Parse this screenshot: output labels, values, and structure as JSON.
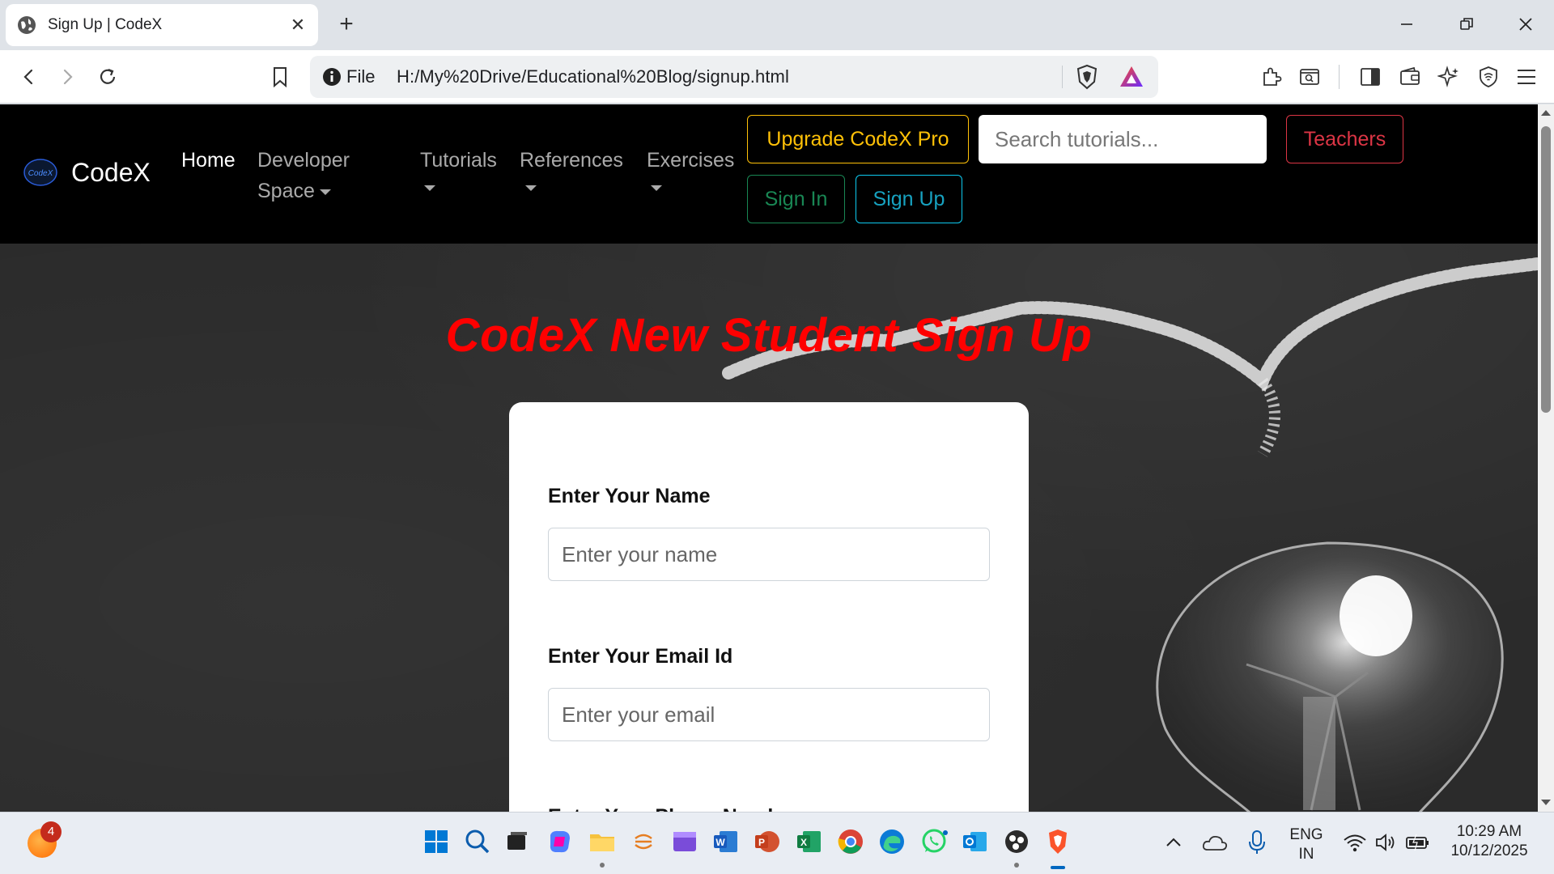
{
  "browser": {
    "tab_title": "Sign Up | CodeX",
    "address_scheme": "File",
    "url": "H:/My%20Drive/Educational%20Blog/signup.html"
  },
  "navbar": {
    "brand": "CodeX",
    "links": {
      "home": "Home",
      "developer_line1": "Developer",
      "developer_line2": "Space",
      "tutorials": "Tutorials",
      "references": "References",
      "exercises": "Exercises"
    },
    "upgrade_button": "Upgrade CodeX Pro",
    "search_placeholder": "Search tutorials...",
    "teachers_button": "Teachers",
    "signin_button": "Sign In",
    "signup_button": "Sign Up"
  },
  "main": {
    "heading": "CodeX New Student Sign Up",
    "form": {
      "name_label": "Enter Your Name",
      "name_placeholder": "Enter your name",
      "email_label": "Enter Your Email Id",
      "email_placeholder": "Enter your email",
      "phone_label": "Enter Your Phone Number"
    }
  },
  "taskbar": {
    "notification_count": "4",
    "language_line1": "ENG",
    "language_line2": "IN",
    "time": "10:29 AM",
    "date": "10/12/2025"
  },
  "colors": {
    "heading": "#ff0000",
    "pro": "#ffc107",
    "teachers": "#dc3545",
    "signin": "#198754",
    "signup": "#0dcaf0"
  }
}
